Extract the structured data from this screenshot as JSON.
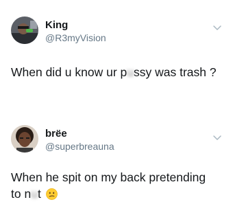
{
  "tweets": [
    {
      "name": "King",
      "handle": "@R3myVision",
      "text_before": "When did u know ur p",
      "censored": "u",
      "text_middle": "ssy was trash ?",
      "avatar_icon": "profile-photo"
    },
    {
      "name": "brëe",
      "handle": "@superbreauna",
      "text_line1": "When he spit on my back pretending",
      "text_line2_before": "to n",
      "censored": "u",
      "text_line2_after": "t",
      "emoji": "confused-face-emoji",
      "avatar_icon": "profile-photo"
    }
  ],
  "icons": {
    "chevron": "chevron-down-icon"
  },
  "colors": {
    "name": "#14171a",
    "handle": "#657786",
    "text": "#14171a"
  }
}
